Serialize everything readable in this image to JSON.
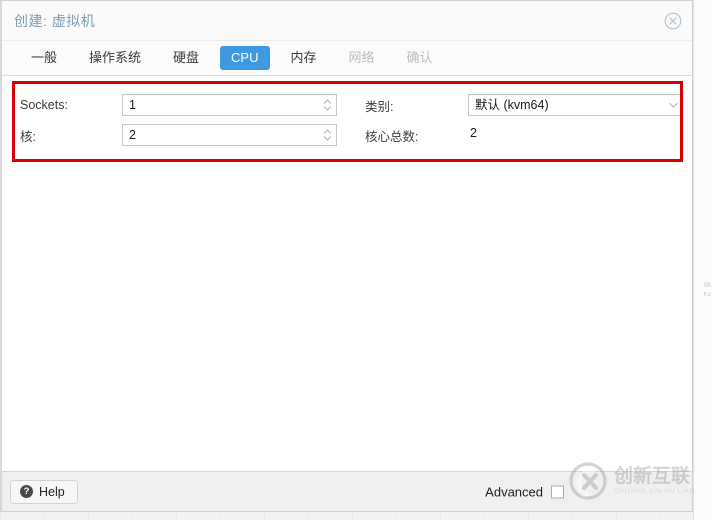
{
  "window": {
    "title": "创建: 虚拟机",
    "close_icon": "close-circle-icon"
  },
  "tabs": [
    {
      "label": "一般",
      "state": "normal"
    },
    {
      "label": "操作系统",
      "state": "normal"
    },
    {
      "label": "硬盘",
      "state": "normal"
    },
    {
      "label": "CPU",
      "state": "active"
    },
    {
      "label": "内存",
      "state": "normal"
    },
    {
      "label": "网络",
      "state": "disabled"
    },
    {
      "label": "确认",
      "state": "disabled"
    }
  ],
  "form": {
    "sockets": {
      "label": "Sockets:",
      "value": "1",
      "spinner_icon": "spinner-updown-icon"
    },
    "cores": {
      "label": "核:",
      "value": "2",
      "spinner_icon": "spinner-updown-icon"
    },
    "type": {
      "label": "类别:",
      "value": "默认 (kvm64)",
      "caret_icon": "chevron-down-icon"
    },
    "total_cores": {
      "label": "核心总数:",
      "value": "2"
    }
  },
  "footer": {
    "help_label": "Help",
    "help_icon": "question-mark-icon",
    "advanced_label": "Advanced",
    "advanced_checked": false
  },
  "watermark": {
    "cn": "创新互联",
    "en": "CHUANG XIN HU LIAN",
    "mark_icon": "cx-logo-icon"
  },
  "background": {
    "right_edge_text": "8 2"
  },
  "colors": {
    "accent": "#3d9ae0",
    "title": "#7a9cb5",
    "annotation": "#d60000",
    "dialog_bg": "#ffffff",
    "footer_bg": "#f0f0f0"
  }
}
